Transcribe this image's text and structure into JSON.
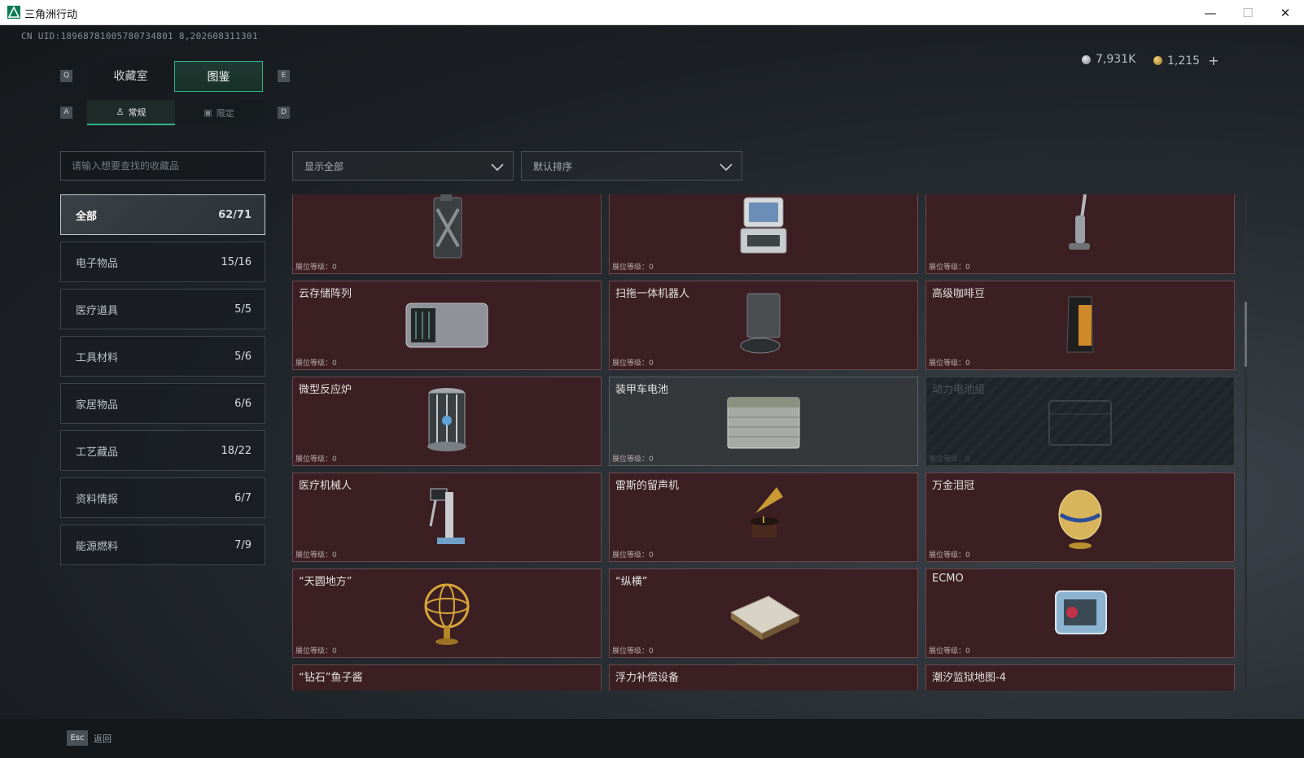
{
  "window": {
    "title": "三角洲行动"
  },
  "uid": "CN UID:18968781005780734801 8,202608311301",
  "currency": {
    "silver": "7,931K",
    "gold": "1,215",
    "plus": "+"
  },
  "keys": {
    "q": "Q",
    "e": "E",
    "a": "A",
    "d": "D"
  },
  "tabs": {
    "main": [
      "收藏室",
      "图鉴"
    ],
    "sub": [
      "常规",
      "限定"
    ]
  },
  "search": {
    "placeholder": "请输入想要查找的收藏品"
  },
  "filters": {
    "show": "显示全部",
    "sort": "默认排序"
  },
  "categories": [
    {
      "label": "全部",
      "count": "62/71"
    },
    {
      "label": "电子物品",
      "count": "15/16"
    },
    {
      "label": "医疗道具",
      "count": "5/5"
    },
    {
      "label": "工具材料",
      "count": "5/6"
    },
    {
      "label": "家居物品",
      "count": "6/6"
    },
    {
      "label": "工艺藏品",
      "count": "18/22"
    },
    {
      "label": "资料情报",
      "count": "6/7"
    },
    {
      "label": "能源燃料",
      "count": "7/9"
    }
  ],
  "level_label": "展位等级：0",
  "items": [
    {
      "name": "",
      "icon": "jerrycan-icon"
    },
    {
      "name": "",
      "icon": "medical-monitor-icon"
    },
    {
      "name": "",
      "icon": "vacuum-cleaner-icon"
    },
    {
      "name": "云存储阵列",
      "icon": "storage-array-icon"
    },
    {
      "name": "扫拖一体机器人",
      "icon": "mop-robot-icon"
    },
    {
      "name": "高级咖啡豆",
      "icon": "coffee-bag-icon"
    },
    {
      "name": "微型反应炉",
      "icon": "reactor-icon"
    },
    {
      "name": "装甲车电池",
      "icon": "vehicle-battery-icon"
    },
    {
      "name": "动力电池组",
      "icon": "battery-pack-icon"
    },
    {
      "name": "医疗机械人",
      "icon": "medical-robot-icon"
    },
    {
      "name": "雷斯的留声机",
      "icon": "gramophone-icon"
    },
    {
      "name": "万金泪冠",
      "icon": "jeweled-egg-icon"
    },
    {
      "name": "“天圆地方”",
      "icon": "armillary-sphere-icon"
    },
    {
      "name": "“纵横”",
      "icon": "chess-board-icon"
    },
    {
      "name": "ECMO",
      "icon": "ecmo-machine-icon"
    },
    {
      "name": "“钻石”鱼子酱",
      "icon": "caviar-tin-icon"
    },
    {
      "name": "浮力补偿设备",
      "icon": "bcd-icon"
    },
    {
      "name": "潮汐监狱地图-4",
      "icon": "map-icon"
    }
  ],
  "bottom": {
    "esc": "Esc",
    "back": "返回"
  },
  "colors": {
    "accent": "#2fb38a",
    "card_bg": "#3b1f23",
    "card_border": "#6b4a4e"
  }
}
